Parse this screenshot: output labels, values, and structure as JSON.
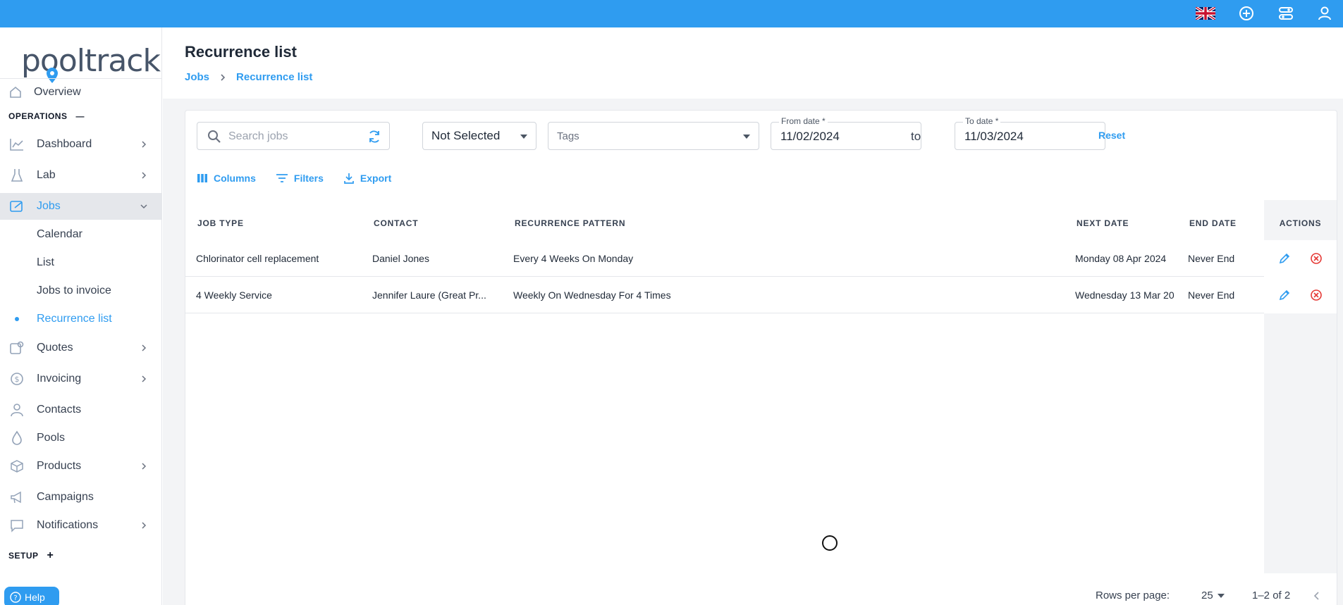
{
  "header": {
    "icons": [
      "uk-flag-icon",
      "add-circle-icon",
      "settings-sliders-icon",
      "user-icon"
    ]
  },
  "logo": {
    "text": "pooltrackr"
  },
  "sidebar": {
    "overview": "Overview",
    "operations_label": "OPERATIONS",
    "operations_toggle": "—",
    "items": [
      {
        "label": "Dashboard",
        "icon": "chart-line-icon"
      },
      {
        "label": "Lab",
        "icon": "flask-icon"
      },
      {
        "label": "Jobs",
        "icon": "jobs-icon"
      },
      {
        "label": "Quotes",
        "icon": "quote-icon"
      },
      {
        "label": "Invoicing",
        "icon": "dollar-icon"
      },
      {
        "label": "Contacts",
        "icon": "person-icon"
      },
      {
        "label": "Pools",
        "icon": "drop-icon"
      },
      {
        "label": "Products",
        "icon": "box-icon"
      },
      {
        "label": "Campaigns",
        "icon": "megaphone-icon"
      },
      {
        "label": "Notifications",
        "icon": "chat-icon"
      }
    ],
    "jobs_sub": [
      "Calendar",
      "List",
      "Jobs to invoice",
      "Recurrence list"
    ],
    "setup_label": "SETUP",
    "setup_toggle": "+",
    "help": "Help"
  },
  "page": {
    "title": "Recurrence list",
    "breadcrumb": [
      "Jobs",
      "Recurrence list"
    ]
  },
  "filters": {
    "search_placeholder": "Search jobs",
    "status_select": "Not Selected",
    "tags_placeholder": "Tags",
    "from_label": "From date *",
    "from_value": "11/02/2024",
    "to_text": "to",
    "to_label": "To date *",
    "to_value": "11/03/2024",
    "reset": "Reset"
  },
  "toolbar": {
    "columns": "Columns",
    "filters": "Filters",
    "export": "Export"
  },
  "table": {
    "headers": [
      "JOB TYPE",
      "CONTACT",
      "RECURRENCE PATTERN",
      "NEXT DATE",
      "END DATE",
      "ACTIONS"
    ],
    "rows": [
      [
        "Chlorinator cell replacement",
        "Daniel Jones",
        "Every 4 Weeks On Monday",
        "Monday 08 Apr 2024",
        "Never End"
      ],
      [
        "4 Weekly Service",
        "Jennifer Laure (Great Pr...",
        "Weekly On Wednesday For 4 Times",
        "Wednesday 13 Mar 20",
        "Never End"
      ]
    ]
  },
  "pagination": {
    "rows_per_page_label": "Rows per page:",
    "rows_per_page": "25",
    "range": "1–2 of 2"
  },
  "colors": {
    "accent": "#2f9cf0",
    "danger": "#e53935"
  }
}
